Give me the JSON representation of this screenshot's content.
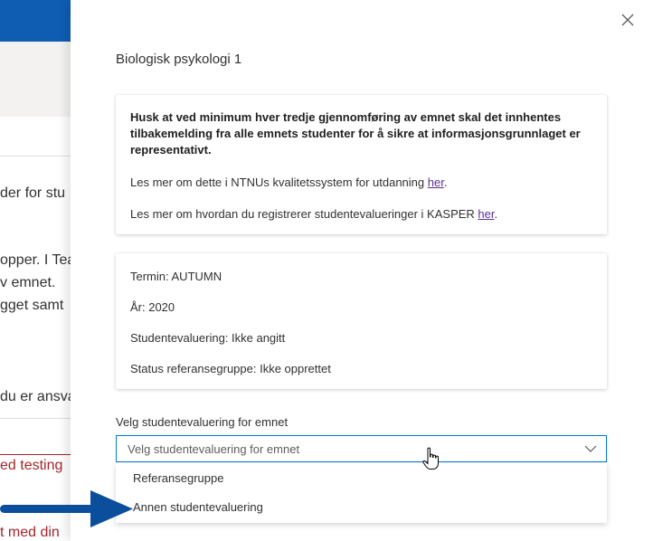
{
  "background": {
    "lines": [
      "der for stu",
      "opper. I Tea",
      "v emnet.",
      "gget samt",
      "du er ansva",
      "ed testing",
      "t med din"
    ]
  },
  "panel": {
    "title": "Biologisk psykologi 1",
    "close_icon": "close-icon",
    "info_card": {
      "bold_text": "Husk at ved minimum hver tredje gjennomføring av emnet skal det innhentes tilbakemelding fra alle emnets studenter for å sikre at informasjonsgrunnlaget er representativt.",
      "line1_text": "Les mer om dette i NTNUs kvalitetssystem for utdanning ",
      "line1_link": "her",
      "line1_end": ".",
      "line2_text": "Les mer om hvordan du registrerer studentevalueringer i KASPER ",
      "line2_link": "her",
      "line2_end": "."
    },
    "details_card": {
      "termin": "Termin: AUTUMN",
      "aar": "År: 2020",
      "studentevaluering": "Studentevaluering: Ikke angitt",
      "status": "Status referansegruppe: Ikke opprettet"
    },
    "select": {
      "label": "Velg studentevaluering for emnet",
      "placeholder": "Velg studentevaluering for emnet",
      "options": [
        "Referansegruppe",
        "Annen studentevaluering"
      ]
    }
  },
  "colors": {
    "accent": "#0078d4",
    "topbar": "#0f5db3",
    "arrow": "#0b4f9c",
    "link": "#5c2d91",
    "error": "#a4262c"
  }
}
